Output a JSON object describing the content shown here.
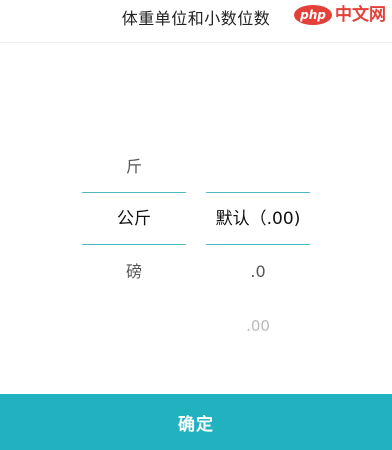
{
  "header": {
    "title": "体重单位和小数位数"
  },
  "watermark": {
    "logo_text": "php",
    "site_text": "中文网"
  },
  "unit_picker": {
    "items": [
      "斤",
      "公斤",
      "磅"
    ],
    "selected": "公斤"
  },
  "decimal_picker": {
    "items": [
      "默认（.00)",
      ".0",
      ".00"
    ],
    "selected": "默认（.00)"
  },
  "confirm_button": {
    "label": "确定"
  },
  "colors": {
    "accent": "#21b1bf",
    "selection_line": "#4fb9c4",
    "watermark": "#e3403a"
  }
}
